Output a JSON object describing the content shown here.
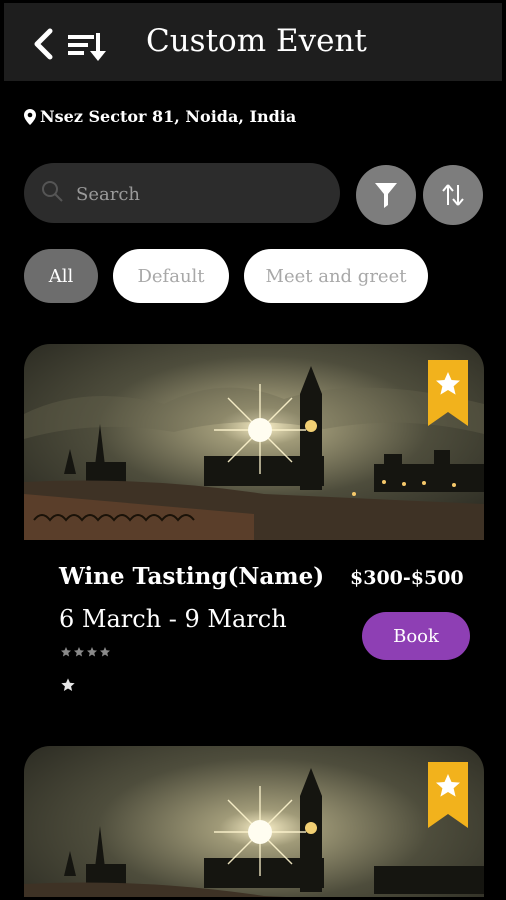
{
  "header": {
    "title": "Custom Event"
  },
  "location": {
    "text": "Nsez Sector 81, Noida, India"
  },
  "search": {
    "placeholder": "Search",
    "value": ""
  },
  "chips": [
    {
      "label": "All",
      "active": true
    },
    {
      "label": "Default",
      "active": false
    },
    {
      "label": "Meet and greet",
      "active": false
    }
  ],
  "events": [
    {
      "name": "Wine Tasting(Name)",
      "price": "$300-$500",
      "date": "6 March - 9 March",
      "book_label": "Book",
      "rating": 4,
      "bookmarked": true
    },
    {
      "bookmarked": true
    }
  ],
  "colors": {
    "accent": "#8e3fb4",
    "ribbon": "#f2b21c",
    "appbar": "#1e1e1e"
  }
}
